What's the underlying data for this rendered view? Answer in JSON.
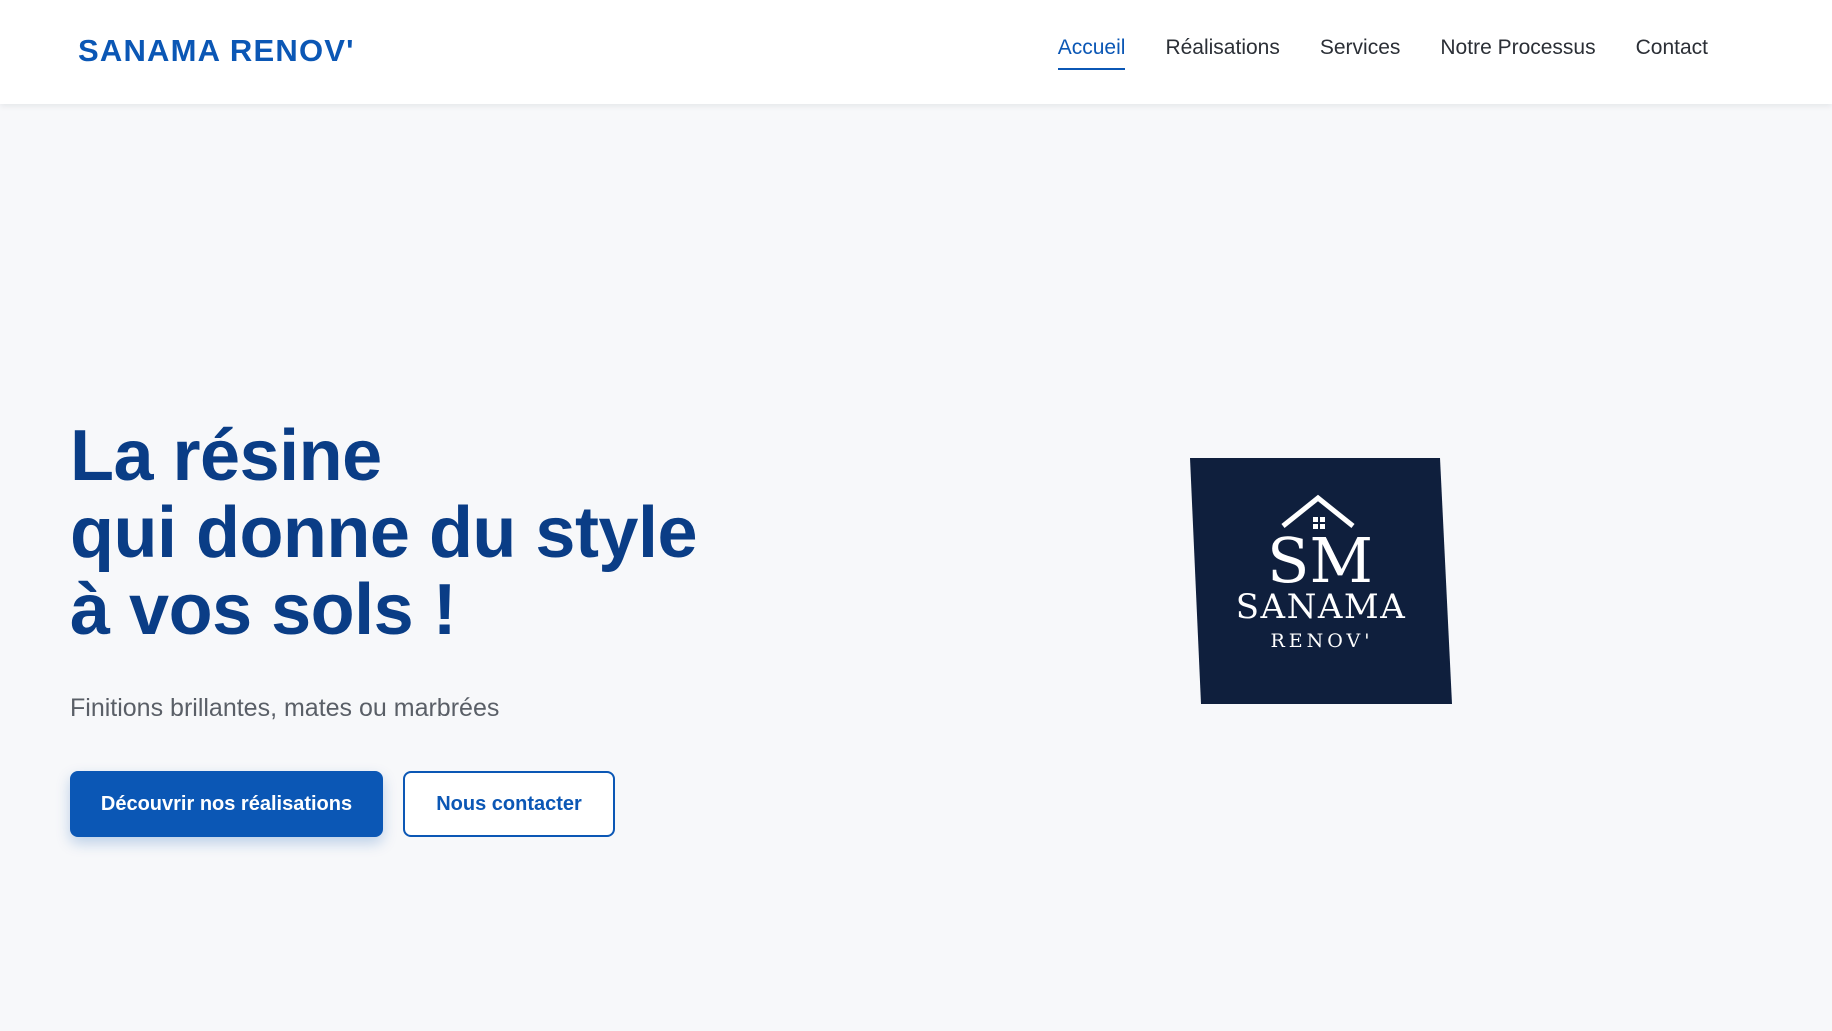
{
  "header": {
    "brand": "SANAMA RENOV'",
    "nav": [
      {
        "label": "Accueil",
        "active": true
      },
      {
        "label": "Réalisations",
        "active": false
      },
      {
        "label": "Services",
        "active": false
      },
      {
        "label": "Notre Processus",
        "active": false
      },
      {
        "label": "Contact",
        "active": false
      }
    ]
  },
  "hero": {
    "title_lines": [
      "La résine",
      "qui donne du style",
      "à vos sols !"
    ],
    "subtitle": "Finitions brillantes, mates ou marbrées",
    "primary_button": "Découvrir nos réalisations",
    "secondary_button": "Nous contacter"
  },
  "logo": {
    "monogram": "SM",
    "name": "SANAMA",
    "tagline": "RENOV'",
    "background_color": "#0f1f3d"
  },
  "colors": {
    "accent": "#0b57b5",
    "heading": "#0a3d86",
    "page_background": "#f7f8fa"
  }
}
